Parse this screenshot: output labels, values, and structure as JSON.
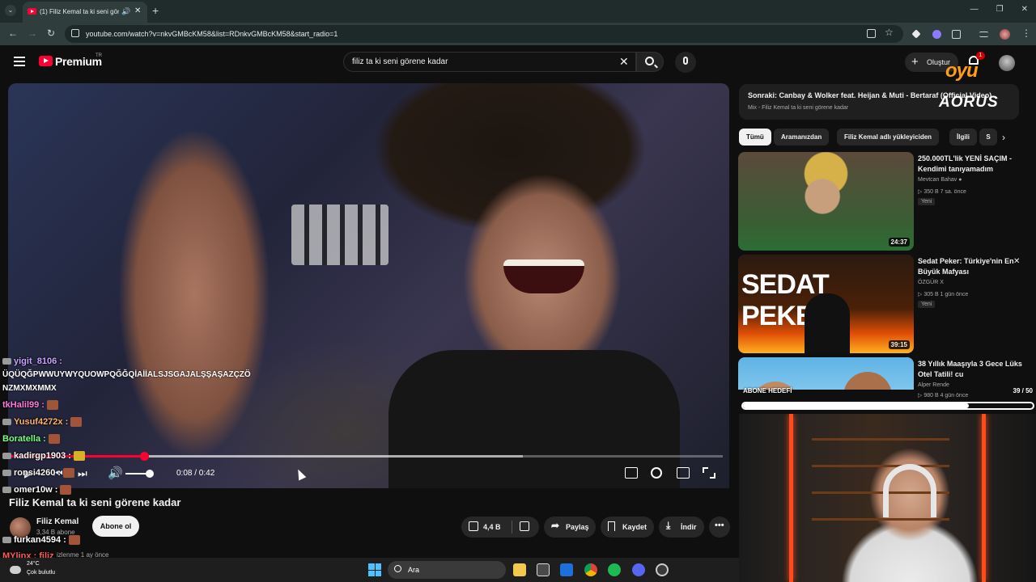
{
  "browser": {
    "tab_title": "(1) Filiz Kemal ta ki seni göre",
    "url": "youtube.com/watch?v=nkvGMBcKM58&list=RDnkvGMBcKM58&start_radio=1"
  },
  "masthead": {
    "logo": "Premium",
    "region": "TR",
    "search_value": "filiz ta ki seni görene kadar",
    "create_label": "Oluştur",
    "notif_count": "1"
  },
  "overlay_brand": {
    "oyu": "oyu",
    "aorus": "AORUS"
  },
  "player": {
    "time": "0:08 / 0:42",
    "progress_fraction": 0.19,
    "buffered_fraction": 0.72
  },
  "video": {
    "title": "Filiz Kemal ta ki seni görene kadar",
    "channel": "Filiz Kemal",
    "subscribers": "3,34 B abone",
    "subscribe_label": "Abone ol",
    "likes": "4,4 B",
    "share_label": "Paylaş",
    "save_label": "Kaydet",
    "download_label": "İndir",
    "views": "izlenme  1 ay önce"
  },
  "up_next": {
    "title": "Sonraki: Canbay & Wolker feat. Heijan & Muti - Bertaraf (Official Video)",
    "subtitle": "Mix - Filiz Kemal ta ki seni görene kadar"
  },
  "chips": [
    "Tümü",
    "Aramanızdan",
    "Filiz Kemal adlı yükleyiciden",
    "İlgili",
    "S"
  ],
  "recommendations": [
    {
      "title": "250.000TL'lik YENİ SAÇIM - Kendimi tanıyamadım",
      "channel": "Mevtcan Bahav",
      "meta": "▷ 350 B   7 sa. önce",
      "badge": "Yeni",
      "duration": "24:37"
    },
    {
      "title": "Sedat Peker: Türkiye'nin En Büyük Mafyası",
      "channel": "ÖZGÜR X",
      "meta": "▷ 305 B   1 gün önce",
      "badge": "Yeni",
      "duration": "39:15",
      "thumb_text": "SEDAT PEKER"
    },
    {
      "title": "38 Yıllık Maaşıyla 3 Gece Lüks Otel Tatili! cu",
      "channel": "Alper Rende",
      "meta": "▷ 980 B   4 gün önce"
    }
  ],
  "goal": {
    "label": "ABONE HEDEFİ",
    "count": "39 / 50",
    "fraction": 0.78
  },
  "chat": [
    {
      "user": "yigit_8106 :",
      "color": "#c9a4ff"
    },
    {
      "user": "tkHalil99 :",
      "color": "#ff7ad9"
    },
    {
      "user": "Yusuf4272x :",
      "color": "#ffb36b"
    },
    {
      "user": "Boratella :",
      "color": "#7cff8a"
    },
    {
      "user": "kadirgp1903 :",
      "color": "#ffffff"
    },
    {
      "user": "ronsi4260 :",
      "color": "#ffffff"
    },
    {
      "user": "omer10w :",
      "color": "#ffffff"
    },
    {
      "user": "furkan4594 :",
      "color": "#ffffff"
    },
    {
      "user": "MYlinx : filiz",
      "color": "#ff5a5a"
    }
  ],
  "chat_text": [
    "ÜQÜQĞPWWUYWYQUOWPQĞĞQİAİİALSJSGAJALŞŞAŞAZÇZÖ",
    "NZMXMXMMX"
  ],
  "taskbar": {
    "temp": "24°C",
    "condition": "Çok bulutlu",
    "search": "Ara"
  }
}
